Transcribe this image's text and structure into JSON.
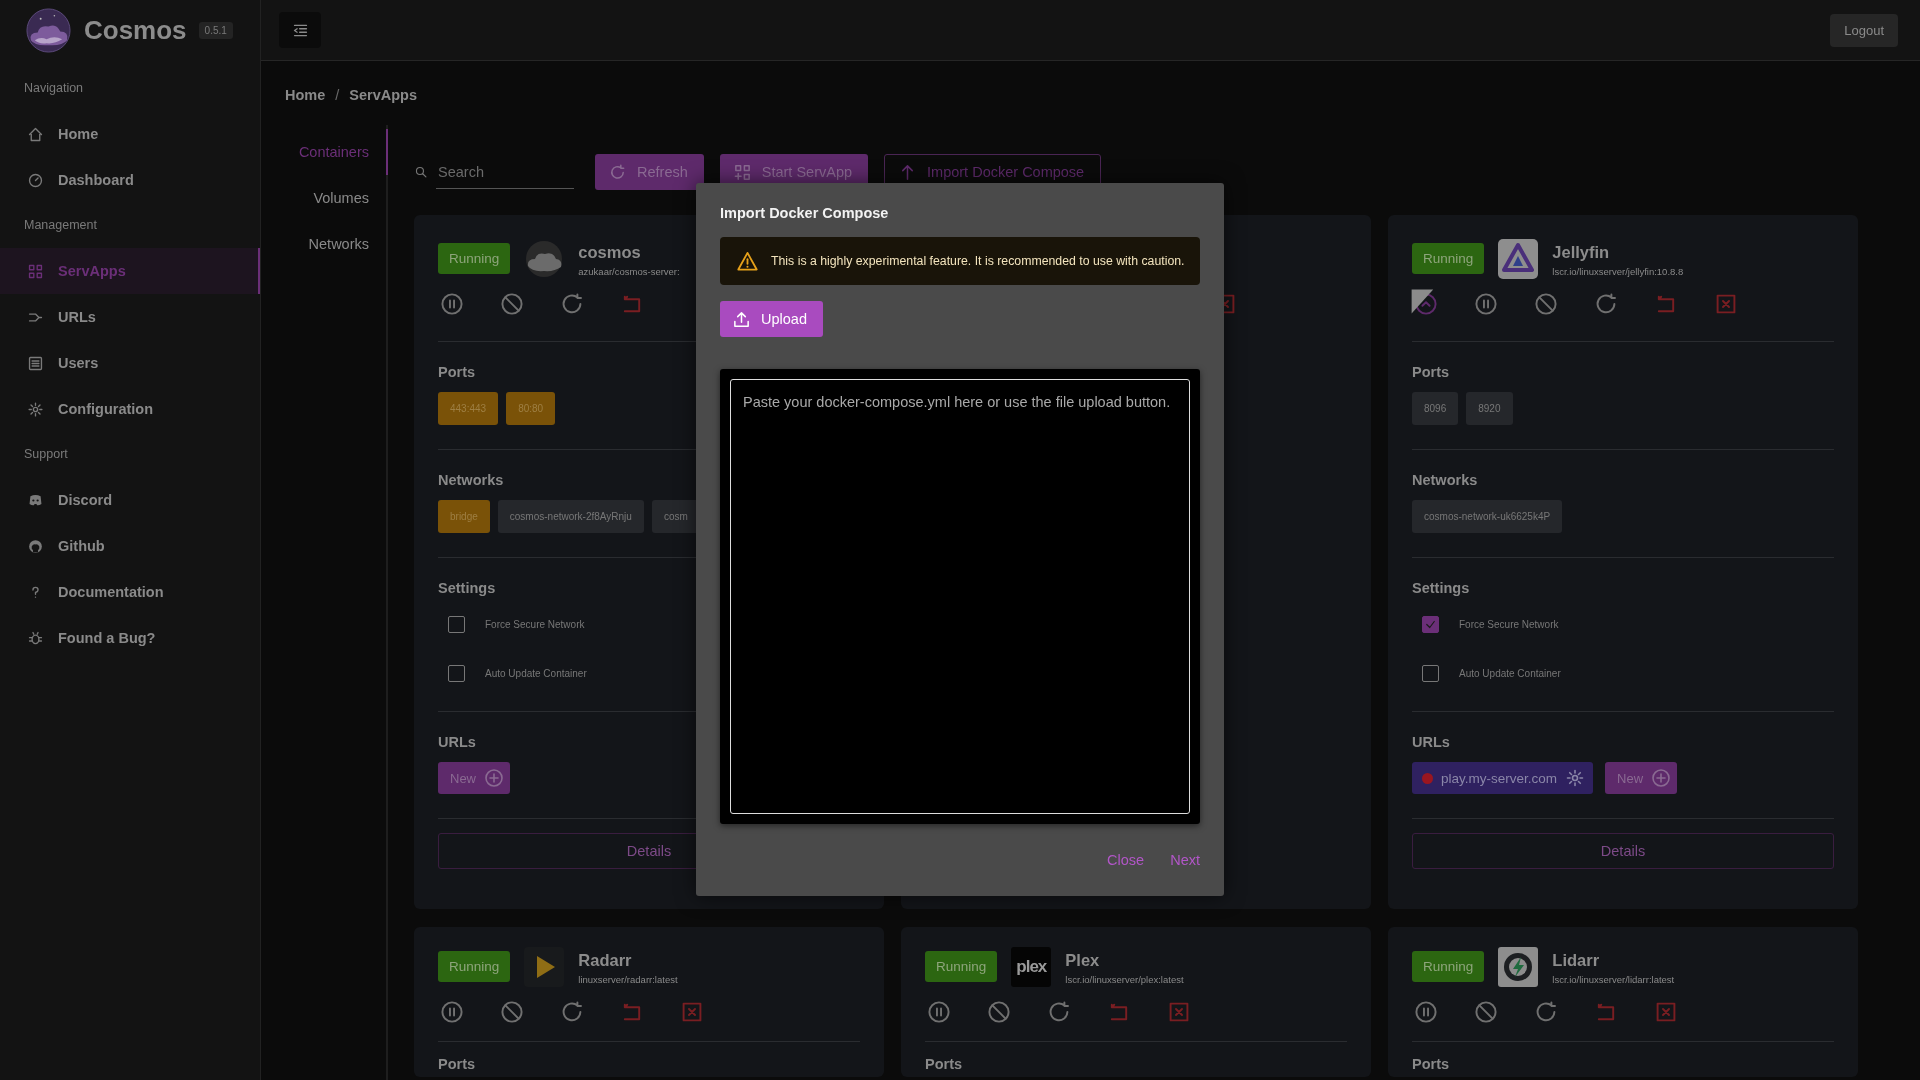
{
  "app": {
    "name": "Cosmos",
    "version": "0.5.1"
  },
  "header": {
    "logout": "Logout"
  },
  "sidebar": {
    "sections": [
      {
        "title": "Navigation",
        "items": [
          {
            "label": "Home",
            "selected": false
          },
          {
            "label": "Dashboard",
            "selected": false
          }
        ]
      },
      {
        "title": "Management",
        "items": [
          {
            "label": "ServApps",
            "selected": true
          },
          {
            "label": "URLs",
            "selected": false
          },
          {
            "label": "Users",
            "selected": false
          },
          {
            "label": "Configuration",
            "selected": false
          }
        ]
      },
      {
        "title": "Support",
        "items": [
          {
            "label": "Discord",
            "selected": false
          },
          {
            "label": "Github",
            "selected": false
          },
          {
            "label": "Documentation",
            "selected": false
          },
          {
            "label": "Found a Bug?",
            "selected": false
          }
        ]
      }
    ]
  },
  "breadcrumb": {
    "items": [
      "Home",
      "ServApps"
    ],
    "separator": "/"
  },
  "subnav": [
    {
      "label": "Containers",
      "selected": true
    },
    {
      "label": "Volumes",
      "selected": false
    },
    {
      "label": "Networks",
      "selected": false
    }
  ],
  "toolbar": {
    "search": {
      "placeholder": "Search"
    },
    "buttons": [
      {
        "label": "Refresh",
        "kind": "filled"
      },
      {
        "label": "Start ServApp",
        "kind": "filled"
      },
      {
        "label": "Import Docker Compose",
        "kind": "outlined"
      }
    ]
  },
  "cards": [
    {
      "kind": "full",
      "status": "Running",
      "name": "cosmos",
      "image": "azukaar/cosmos-server:",
      "actions": [
        {
          "kind": "pause"
        },
        {
          "kind": "stop"
        },
        {
          "kind": "restart"
        },
        {
          "kind": "recreate"
        }
      ],
      "ports": [
        {
          "label": "443:443",
          "highlighted": true
        },
        {
          "label": "80:80",
          "highlighted": true
        }
      ],
      "networks": [
        {
          "label": "bridge",
          "highlighted": true
        },
        {
          "label": "cosmos-network-2f8AyRnju",
          "highlighted": false
        },
        {
          "label": "cosm",
          "highlighted": false
        }
      ],
      "sections": {
        "ports": "Ports",
        "networks": "Networks",
        "settings": "Settings",
        "urls": "URLs"
      },
      "settings": [
        {
          "label": "Force Secure Network",
          "checked": false
        },
        {
          "label": "Auto Update Container",
          "checked": false
        }
      ],
      "urls": [
        {
          "kind": "new",
          "label": "New"
        }
      ],
      "details": "Details"
    },
    {
      "kind": "covered",
      "actions": [
        {
          "kind": "delete"
        }
      ]
    },
    {
      "kind": "full",
      "status": "Running",
      "name": "Jellyfin",
      "image": "lscr.io/linuxserver/jellyfin:10.8.8",
      "actions": [
        {
          "kind": "update"
        },
        {
          "kind": "pause"
        },
        {
          "kind": "stop"
        },
        {
          "kind": "restart"
        },
        {
          "kind": "recreate"
        },
        {
          "kind": "delete"
        }
      ],
      "ports": [
        {
          "label": "8096",
          "highlighted": false
        },
        {
          "label": "8920",
          "highlighted": false
        }
      ],
      "networks": [
        {
          "label": "cosmos-network-uk6625k4P",
          "highlighted": false
        }
      ],
      "sections": {
        "ports": "Ports",
        "networks": "Networks",
        "settings": "Settings",
        "urls": "URLs"
      },
      "settings": [
        {
          "label": "Force Secure Network",
          "checked": true
        },
        {
          "label": "Auto Update Container",
          "checked": false
        }
      ],
      "urls": [
        {
          "kind": "link",
          "label": "play.my-server.com"
        },
        {
          "kind": "new",
          "label": "New"
        }
      ],
      "details": "Details"
    },
    {
      "kind": "compact",
      "status": "Running",
      "name": "Radarr",
      "image": "linuxserver/radarr:latest",
      "actions": [
        {
          "kind": "pause"
        },
        {
          "kind": "stop"
        },
        {
          "kind": "restart"
        },
        {
          "kind": "recreate"
        },
        {
          "kind": "delete"
        }
      ],
      "sections": {
        "ports": "Ports"
      }
    },
    {
      "kind": "compact",
      "status": "Running",
      "logo_text": "plex",
      "name": "Plex",
      "image": "lscr.io/linuxserver/plex:latest",
      "actions": [
        {
          "kind": "pause"
        },
        {
          "kind": "stop"
        },
        {
          "kind": "restart"
        },
        {
          "kind": "recreate"
        },
        {
          "kind": "delete"
        }
      ],
      "sections": {
        "ports": "Ports"
      }
    },
    {
      "kind": "compact",
      "status": "Running",
      "name": "Lidarr",
      "image": "lscr.io/linuxserver/lidarr:latest",
      "actions": [
        {
          "kind": "pause"
        },
        {
          "kind": "stop"
        },
        {
          "kind": "restart"
        },
        {
          "kind": "recreate"
        },
        {
          "kind": "delete"
        }
      ],
      "sections": {
        "ports": "Ports"
      }
    }
  ],
  "dialog": {
    "title": "Import Docker Compose",
    "warning": "This is a highly experimental feature. It is recommended to use with caution.",
    "upload": "Upload",
    "editor": {
      "placeholder": "Paste your docker-compose.yml here or use the file upload button."
    },
    "buttons": [
      "Close",
      "Next"
    ]
  }
}
